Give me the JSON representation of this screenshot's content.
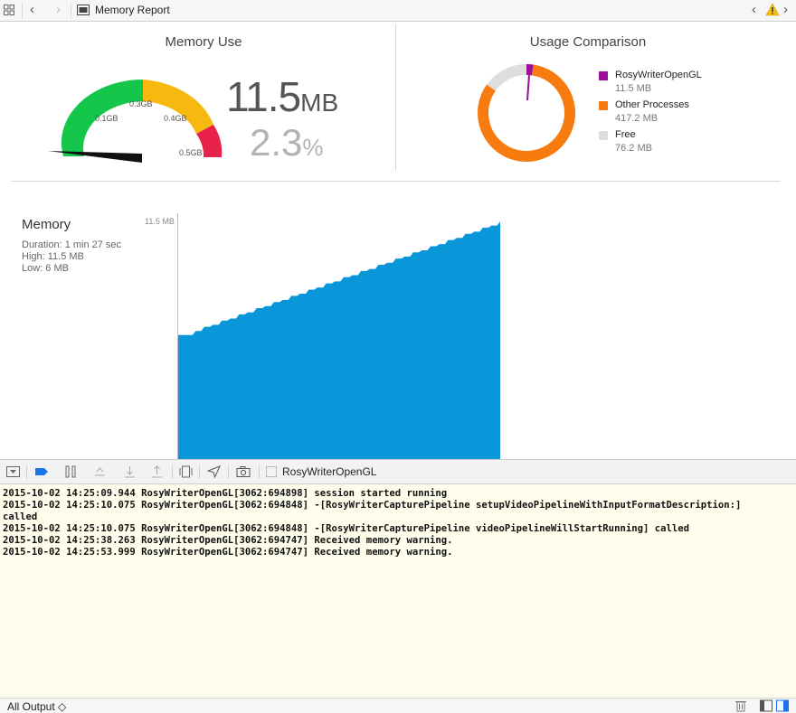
{
  "topbar": {
    "crumb": "Memory Report"
  },
  "memory_use": {
    "title": "Memory Use",
    "value": "11.5",
    "value_unit": "MB",
    "percent": "2.3",
    "percent_unit": "%",
    "gauge_labels": [
      "0.1GB",
      "0.3GB",
      "0.4GB",
      "0.5GB"
    ],
    "gauge_colors": [
      "#14c64a",
      "#f7b80f",
      "#e8224a"
    ]
  },
  "usage_comparison": {
    "title": "Usage Comparison",
    "items": [
      {
        "name": "RosyWriterOpenGL",
        "value": "11.5 MB",
        "mb": 11.5,
        "color": "#9b0f9b"
      },
      {
        "name": "Other Processes",
        "value": "417.2 MB",
        "mb": 417.2,
        "color": "#f77b0f"
      },
      {
        "name": "Free",
        "value": "76.2 MB",
        "mb": 76.2,
        "color": "#dedede"
      }
    ]
  },
  "memory_panel": {
    "title": "Memory",
    "duration": "Duration: 1 min 27 sec",
    "high": "High: 11.5 MB",
    "low": "Low: 6 MB",
    "y_tick": "11.5 MB"
  },
  "chart_data": {
    "type": "area",
    "title": "Memory",
    "ylabel": "",
    "xlabel": "",
    "y_tick_labels": [
      "11.5 MB"
    ],
    "ylim": [
      0,
      11.5
    ],
    "color": "#0a97da",
    "series": [
      {
        "values": [
          6.0,
          6.0,
          6.2,
          6.4,
          6.5,
          6.7,
          6.8,
          7.0,
          7.1,
          7.3,
          7.4,
          7.6,
          7.7,
          7.9,
          8.0,
          8.2,
          8.3,
          8.5,
          8.6,
          8.8,
          8.9,
          9.1,
          9.2,
          9.4,
          9.5,
          9.7,
          9.8,
          10.0,
          10.1,
          10.3,
          10.4,
          10.6,
          10.7,
          10.9,
          11.0,
          11.2,
          11.3,
          11.5
        ]
      }
    ]
  },
  "toolbar": {
    "target": "RosyWriterOpenGL"
  },
  "console": {
    "lines": [
      "2015-10-02 14:25:09.944 RosyWriterOpenGL[3062:694898] session started running",
      "2015-10-02 14:25:10.075 RosyWriterOpenGL[3062:694848] -[RosyWriterCapturePipeline setupVideoPipelineWithInputFormatDescription:]",
      "called",
      "2015-10-02 14:25:10.075 RosyWriterOpenGL[3062:694848] -[RosyWriterCapturePipeline videoPipelineWillStartRunning] called",
      "2015-10-02 14:25:38.263 RosyWriterOpenGL[3062:694747] Received memory warning.",
      "2015-10-02 14:25:53.999 RosyWriterOpenGL[3062:694747] Received memory warning."
    ]
  },
  "statusbar": {
    "filter": "All Output ◇"
  }
}
